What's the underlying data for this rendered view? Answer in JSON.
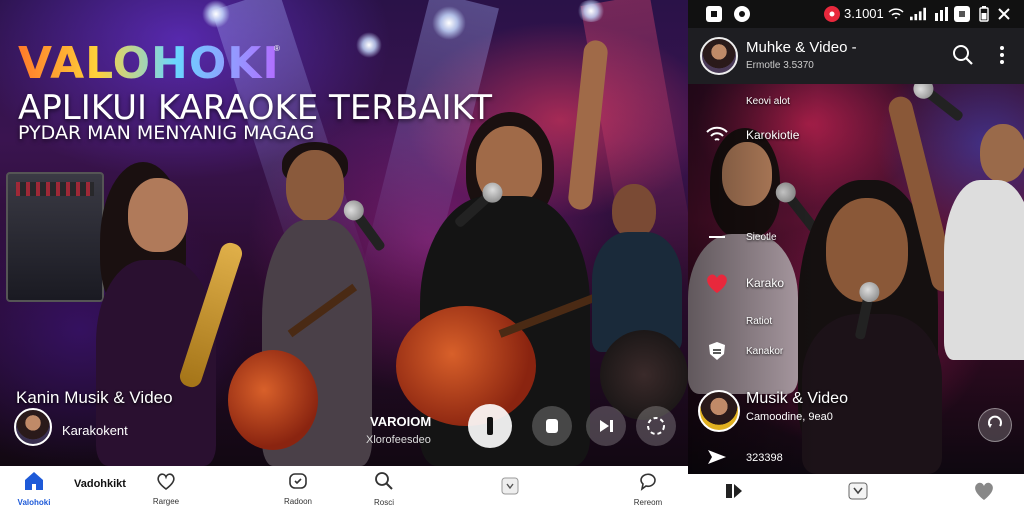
{
  "banner": {
    "brand": "VALOHOKI",
    "brand_tm": "®",
    "headline": "APLIKUI KARAOKE TERBAIKT",
    "subline": "PYDAR MAN MENYANIG MAGAG",
    "video_title": "Kanin Musik & Video",
    "video_user": "Karakokent",
    "mini_title": "VAROIOM",
    "mini_sub": "Xlorofeesdeo",
    "icons": [
      "pause-icon",
      "microphone-icon",
      "skip-icon",
      "replay-icon"
    ]
  },
  "bottom_nav_left": {
    "brand_label": "Vadohkikt",
    "items": [
      {
        "label": "Valohoki",
        "icon": "home-icon",
        "active": true
      },
      {
        "label": "Rargee",
        "icon": "heart-icon",
        "active": false
      },
      {
        "label": "Radoon",
        "icon": "radio-icon",
        "active": false
      },
      {
        "label": "Rosci",
        "icon": "search-icon",
        "active": false
      },
      {
        "label": "",
        "icon": "tray-icon",
        "active": false
      },
      {
        "label": "Rereom",
        "icon": "chat-icon",
        "active": false
      }
    ]
  },
  "status_bar": {
    "time": "3.1001"
  },
  "phone_app_bar": {
    "title": "Muhke & Video -",
    "subtitle": "Ermotle 3.5370",
    "icons": [
      "search-icon",
      "more-vertical-icon"
    ]
  },
  "side_menu": {
    "items": [
      {
        "label": "Keovi alot",
        "icon": ""
      },
      {
        "label": "Karokiotie",
        "icon": "wifi-icon"
      },
      {
        "label": "Sieotle",
        "icon": "slash-icon"
      },
      {
        "label": "Karako",
        "icon": "heart-icon"
      },
      {
        "label": "Ratiot",
        "icon": ""
      },
      {
        "label": "Kanakor",
        "icon": "shield-icon"
      }
    ]
  },
  "phone_card": {
    "title": "Musik & Video",
    "subtitle": "Camoodine, 9ea0",
    "count": "323398"
  },
  "colors": {
    "accent_blue": "#1e5ad8",
    "heart_red": "#e8283c",
    "brand_gradient_start": "#ff7a2a",
    "brand_gradient_end": "#b46aff"
  }
}
